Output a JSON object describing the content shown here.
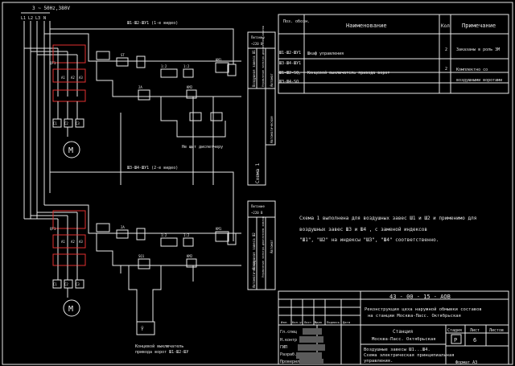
{
  "supply": {
    "label": "3 ~ 50Hz,380V",
    "phases": [
      "L1",
      "L2",
      "L3",
      "N"
    ]
  },
  "circuit_top": {
    "bus_label": "Ш1-Ш2-ШУ1 (1-е видео)",
    "motor": "M",
    "labels": [
      "QF1",
      "КМ1",
      "КМ2",
      "А1",
      "А2",
      "А3",
      "С1",
      "С2",
      "С3",
      "ST",
      "2A",
      "1:2",
      "1:2",
      "КМ1",
      "КМ2",
      "SB",
      "SQ1",
      "SQ2"
    ],
    "no_light": "Не щит диспетчеру",
    "side_panel": [
      "Питание",
      "~220 В",
      "Воздушная завеса Ш1",
      "Управление электро-двигателем завесы",
      "Автомат",
      "Автоматическое"
    ]
  },
  "circuit_bottom": {
    "bus_label": "Ш3-Ш4-ШУ1 (2-е видео)",
    "motor": "M",
    "labels": [
      "QF1",
      "КМ1",
      "КМ2",
      "А1",
      "А2",
      "А3",
      "С1",
      "С2",
      "С3",
      "2A",
      "1:2",
      "1:2",
      "SQ1",
      "КМ1",
      "КМ2"
    ],
    "side_panel": [
      "Питание",
      "~220 В",
      "Воздушная завеса Ш2",
      "Управление электро-двигателем завесы",
      "Автомат",
      "Автоматическое"
    ],
    "limit_switch_caption": [
      "Концевой выключатель",
      "привода ворот Ш1-Ш2-ШУ"
    ]
  },
  "vertical_label": "Схема 1",
  "spec_table": {
    "headers": [
      "Поз. обозн.",
      "Наименование",
      "Кол",
      "Примечание"
    ],
    "rows": [
      {
        "pos": "Ш1-Ш2-ШУ1",
        "name": "Шкаф управления",
        "qty": "2",
        "note": "Заказаны в роль ЗМ"
      },
      {
        "pos": "Ш3-Ш4-ШУ1",
        "name": "",
        "qty": "",
        "note": ""
      },
      {
        "pos": "Ш1-Ш2-SQ,",
        "name": "Концевой выключатель привода ворот",
        "qty": "2",
        "note": "Комплектно со"
      },
      {
        "pos": "Ш3-Ш4-SQ",
        "name": "",
        "qty": "",
        "note": "воздушными воротами"
      }
    ]
  },
  "note": [
    "Схема 1 выполнена для воздушных завес Ш1 и Ш2 и применимо для",
    "воздушных завес Ш3 и Ш4 , с заменой индексов",
    "\"Ш1\", \"Ш2\" на индексы \"Ш3\", \"Ш4\" соответственно."
  ],
  "title_block": {
    "doc_code": "43 - 00 - 15 - АОВ",
    "project": [
      "Реконструкция цеха наружной обмывки составов",
      "на станции Москва-Пасс. Октябрьская"
    ],
    "stamp_cols": [
      "Изм.",
      "Кол.уч",
      "Лист",
      "№док",
      "Подпись",
      "Дата"
    ],
    "roles": [
      "Гл.спец",
      "Н.контр",
      "ГИП",
      "Разраб.",
      "Проверил"
    ],
    "station_label": "Станция",
    "station_name": "Москва-Пасс. Октябрьская",
    "stage_headers": [
      "Стадия",
      "Лист",
      "Листов"
    ],
    "stage": "Р",
    "sheet": "6",
    "sheets_total": "",
    "subject": [
      "Воздушные завесы Ш1...Ш4.",
      "Схема электрическая принципиальная",
      "управления."
    ],
    "format": "Формат А3"
  }
}
